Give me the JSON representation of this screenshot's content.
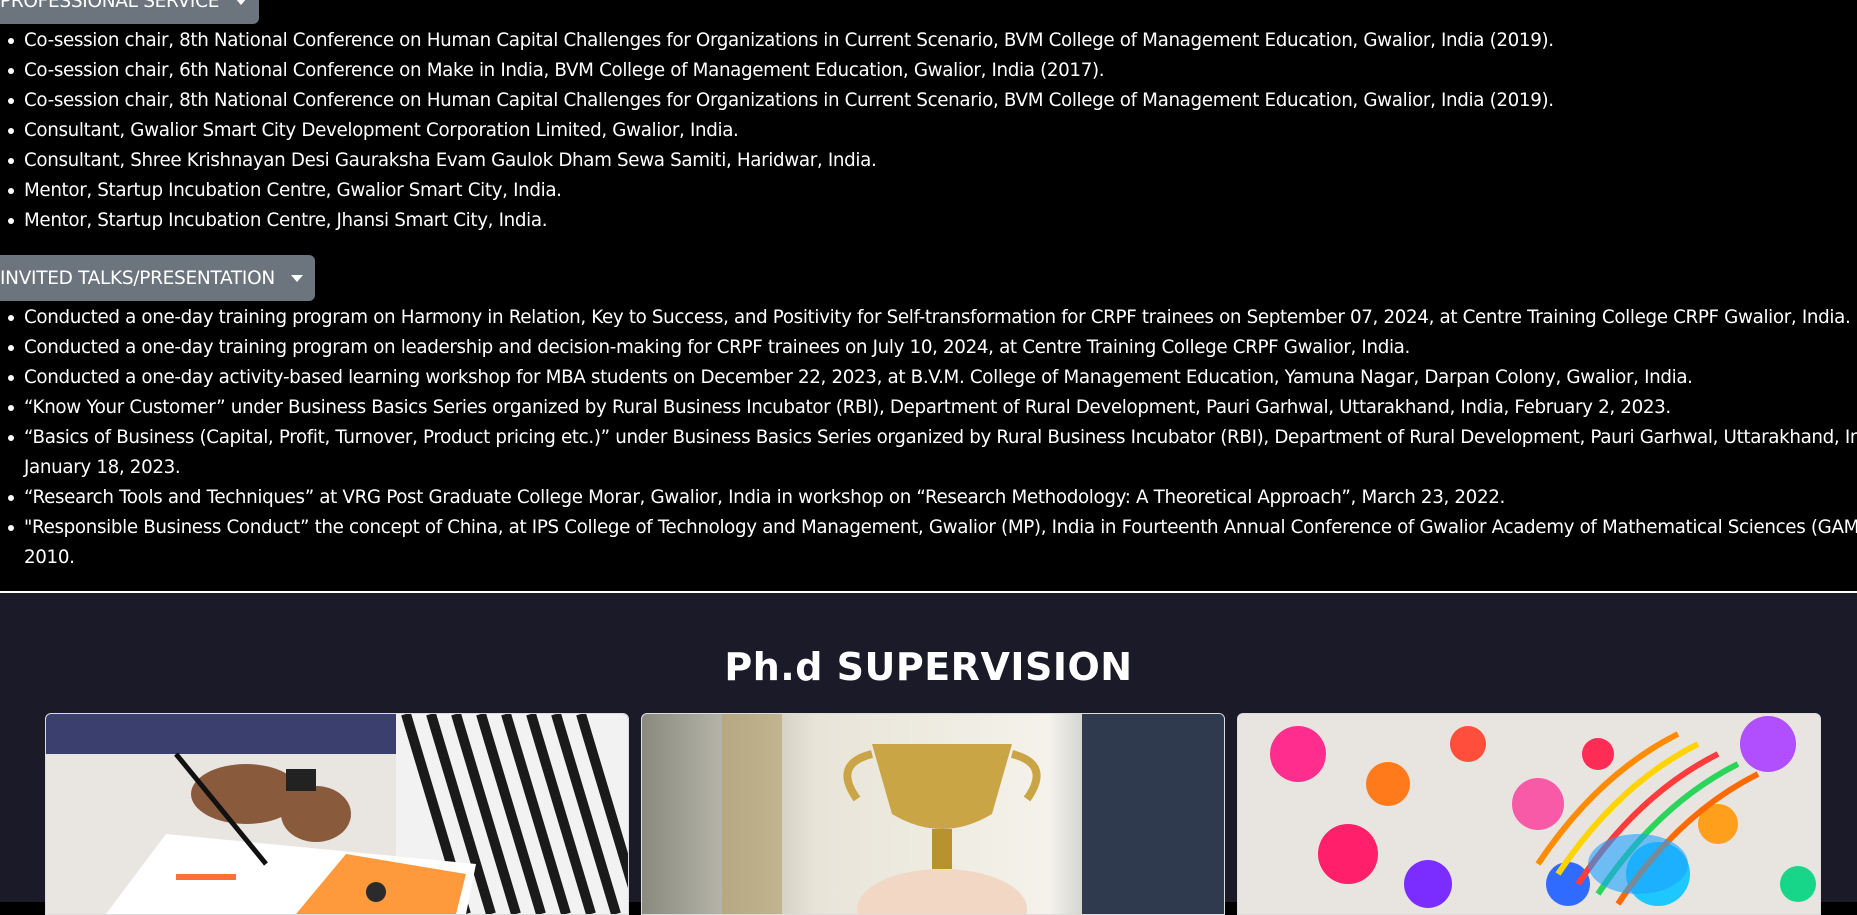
{
  "professional_service": {
    "button_label": "PROFESSIONAL SERVICE",
    "items": [
      "Co-session chair, 8th National Conference on Human Capital Challenges for Organizations in Current Scenario, BVM College of Management Education, Gwalior, India (2019).",
      "Co-session chair, 6th National Conference on Make in India, BVM College of Management Education, Gwalior, India (2017).",
      "Co-session chair, 8th National Conference on Human Capital Challenges for Organizations in Current Scenario, BVM College of Management Education, Gwalior, India (2019).",
      "Consultant, Gwalior Smart City Development Corporation Limited, Gwalior, India.",
      "Consultant, Shree Krishnayan Desi Gauraksha Evam Gaulok Dham Sewa Samiti, Haridwar, India.",
      "Mentor, Startup Incubation Centre, Gwalior Smart City, India.",
      "Mentor, Startup Incubation Centre, Jhansi Smart City, India."
    ]
  },
  "invited_talks": {
    "button_label": "INVITED TALKS/PRESENTATION",
    "items": [
      "Conducted a one-day training program on Harmony in Relation, Key to Success, and Positivity for Self-transformation for CRPF trainees on September 07, 2024, at Centre Training College CRPF Gwalior, India.",
      "Conducted a one-day training program on leadership and decision-making for CRPF trainees on July 10, 2024, at Centre Training College CRPF Gwalior, India.",
      "Conducted a one-day activity-based learning workshop for MBA students on December 22, 2023, at B.V.M. College of Management Education, Yamuna Nagar, Darpan Colony, Gwalior, India.",
      "“Know Your Customer” under Business Basics Series organized by Rural Business Incubator (RBI), Department of Rural Development, Pauri Garhwal, Uttarakhand, India, February 2, 2023.",
      "“Basics of Business (Capital, Profit, Turnover, Product pricing etc.)” under Business Basics Series organized by Rural Business Incubator (RBI), Department of Rural Development, Pauri Garhwal, Uttarakhand, India",
      "January 18, 2023.",
      "“Research Tools and Techniques” at VRG Post Graduate College Morar, Gwalior, India in workshop on “Research Methodology: A Theoretical Approach”, March 23, 2022.",
      "\"Responsible Business Conduct” the concept of China, at IPS College of Technology and Management, Gwalior (MP), India in Fourteenth Annual Conference of Gwalior Academy of Mathematical Sciences (GAM",
      "2010."
    ]
  },
  "phd_supervision": {
    "title": "Ph.d SUPERVISION"
  },
  "colors": {
    "page_background": "#000000",
    "section_background": "#1b1a28",
    "button_background": "#6c757d",
    "text": "#ffffff"
  }
}
